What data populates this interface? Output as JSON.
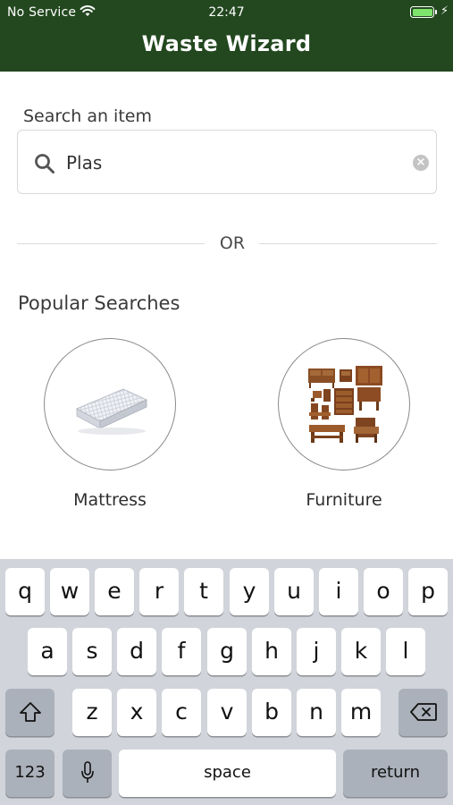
{
  "status_bar": {
    "carrier": "No Service",
    "time": "22:47",
    "wifi_icon": "wifi-icon",
    "battery_icon": "battery-icon",
    "battery_level": 1.0,
    "charging_icon": "⚡"
  },
  "header": {
    "title": "Waste Wizard",
    "background_color": "#23481f"
  },
  "search": {
    "label": "Search an item",
    "value": "Plas",
    "placeholder": "",
    "search_icon": "search-icon",
    "clear_icon": "clear-icon",
    "clear_glyph": "×"
  },
  "divider": {
    "text": "OR"
  },
  "popular": {
    "title": "Popular Searches",
    "items": [
      {
        "label": "Mattress",
        "icon": "mattress-image"
      },
      {
        "label": "Furniture",
        "icon": "furniture-image"
      }
    ]
  },
  "keyboard": {
    "row1": [
      "q",
      "w",
      "e",
      "r",
      "t",
      "y",
      "u",
      "i",
      "o",
      "p"
    ],
    "row2": [
      "a",
      "s",
      "d",
      "f",
      "g",
      "h",
      "j",
      "k",
      "l"
    ],
    "row3": [
      "z",
      "x",
      "c",
      "v",
      "b",
      "n",
      "m"
    ],
    "numbers_label": "123",
    "space_label": "space",
    "return_label": "return",
    "shift_icon": "shift-icon",
    "delete_icon": "delete-icon",
    "mic_icon": "microphone-icon"
  }
}
